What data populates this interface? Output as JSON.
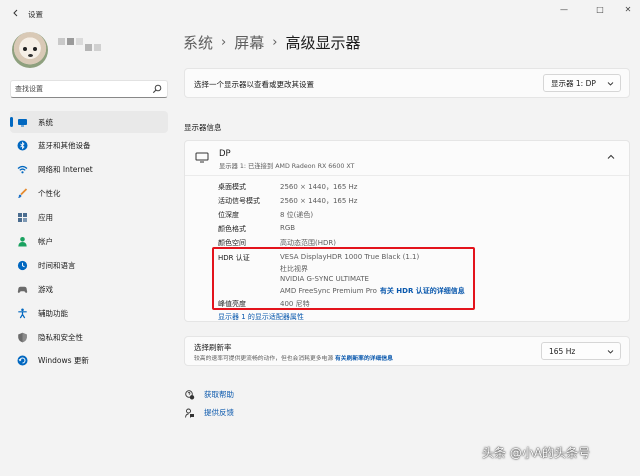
{
  "window": {
    "title": "设置",
    "controls": [
      "—",
      "□",
      "✕"
    ]
  },
  "search": {
    "value": "查找设置"
  },
  "sidebar": {
    "items": [
      {
        "label": "系统",
        "icon": "monitor-icon",
        "color": "#0067c0"
      },
      {
        "label": "蓝牙和其他设备",
        "icon": "bluetooth-icon",
        "color": "#0067c0"
      },
      {
        "label": "网络和 Internet",
        "icon": "wifi-icon",
        "color": "#0067c0"
      },
      {
        "label": "个性化",
        "icon": "brush-icon",
        "color": "#e68a2e"
      },
      {
        "label": "应用",
        "icon": "apps-icon",
        "color": "#4a6c8f"
      },
      {
        "label": "帐户",
        "icon": "account-icon",
        "color": "#1aa260"
      },
      {
        "label": "时间和语言",
        "icon": "globe-clock-icon",
        "color": "#0067c0"
      },
      {
        "label": "游戏",
        "icon": "gamepad-icon",
        "color": "#6b6b6b"
      },
      {
        "label": "辅助功能",
        "icon": "accessibility-icon",
        "color": "#0067c0"
      },
      {
        "label": "隐私和安全性",
        "icon": "shield-icon",
        "color": "#6b6b6b"
      },
      {
        "label": "Windows 更新",
        "icon": "update-icon",
        "color": "#0067c0"
      }
    ]
  },
  "breadcrumb": {
    "part1": "系统",
    "sep1": "›",
    "part2": "屏幕",
    "sep2": "›",
    "current": "高级显示器"
  },
  "select_display": {
    "label": "选择一个显示器以查看或更改其设置",
    "value": "显示器 1: DP"
  },
  "display_info": {
    "section_title": "显示器信息",
    "name": "DP",
    "subtitle": "显示器 1: 已连接到 AMD Radeon RX 6600 XT",
    "props": {
      "desktop_mode": {
        "label": "桌面模式",
        "value": "2560 × 1440，165 Hz"
      },
      "active_signal": {
        "label": "活动信号模式",
        "value": "2560 × 1440，165 Hz"
      },
      "bit_depth": {
        "label": "位深度",
        "value": "8 位(递色)"
      },
      "color_format": {
        "label": "颜色格式",
        "value": "RGB"
      },
      "color_space": {
        "label": "颜色空间",
        "value": "高动态范围(HDR)"
      },
      "hdr_cert": {
        "label": "HDR 认证",
        "line1": "VESA DisplayHDR 1000 True Black (1.1)",
        "line2": "杜比视界",
        "line3": "NVIDIA G-SYNC ULTIMATE",
        "line4": "AMD FreeSync Premium Pro",
        "link": "有关 HDR 认证的详细信息"
      },
      "peak_brightness": {
        "label": "峰值亮度",
        "value": "400 尼特"
      }
    },
    "adapter_link": "显示器 1 的显示适配器属性"
  },
  "refresh": {
    "title": "选择刷新率",
    "desc": "较高的速率可提供更流畅的动作，但也会消耗更多电源",
    "link": "有关刷新率的详细信息",
    "value": "165 Hz"
  },
  "help": {
    "get_help": "获取帮助",
    "feedback": "提供反馈"
  },
  "watermark": "头条 @小A的头条号",
  "colors": {
    "accent": "#0067c0",
    "link": "#0a58ad",
    "highlight_box": "#e3131c"
  }
}
